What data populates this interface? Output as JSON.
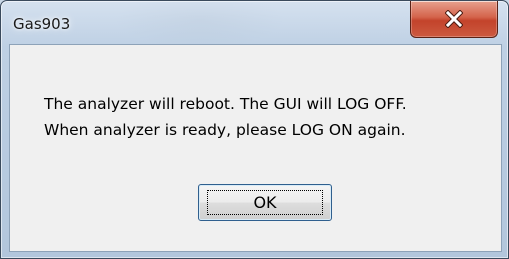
{
  "window": {
    "title": "Gas903"
  },
  "dialog": {
    "message_lines": [
      "The analyzer will reboot. The GUI will LOG OFF.",
      "When analyzer is ready, please LOG ON again."
    ],
    "ok_label": "OK"
  },
  "icons": {
    "close": "close-icon"
  },
  "colors": {
    "close_button": "#c7462d",
    "client_background": "#f0f0f0",
    "frame": "#b8cce0"
  }
}
